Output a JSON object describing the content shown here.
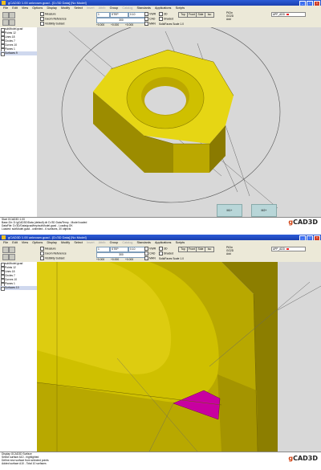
{
  "colors": {
    "nut_face": "#cfc000",
    "nut_light": "#ecdc18",
    "nut_dark": "#8c7e00",
    "highlight": "#c800a0",
    "viewport_bg": "#d8d8d8"
  },
  "window1": {
    "title": "gCAD3D 1.00   unknown.gcad  -  [D:/3D Data]   [No Model]",
    "menu": [
      "File",
      "Edit",
      "View",
      "Options",
      "Display",
      "Modify",
      "Select",
      "Insert",
      "Attrib",
      "Group",
      "Catalog",
      "Standards",
      "Applications",
      "Scripts"
    ],
    "menu_dim": [
      false,
      false,
      false,
      false,
      false,
      false,
      false,
      true,
      true,
      false,
      true,
      false,
      false,
      false
    ],
    "toolbar": {
      "checks": [
        "Measure",
        "Geom Reference",
        "Visibility Subset"
      ],
      "fields": [
        "1",
        "STEP",
        "0.10"
      ],
      "sub_fields": [
        "300",
        "+0.000",
        "+0.000",
        "+0.000"
      ],
      "mode_checks": [
        "VWR",
        "CAD",
        "MAN"
      ],
      "view_checks": [
        "3D",
        "Shaded",
        "Scale"
      ],
      "view_buttons": [
        "Top",
        "Front",
        "Side",
        "Iso"
      ],
      "right_info": [
        "PtCtn",
        "GO2D",
        "Add"
      ],
      "layer": "APP_ADD",
      "status": "SolidFaces   Scale  1.0"
    },
    "tree": [
      "subModel.gcad",
      "Points  12",
      "Lines  18",
      "Circles  7",
      "Curves  10",
      "Planes 1",
      "Surfaces 9"
    ],
    "tree_selected": 6,
    "viewport_buttons": [
      "M1+",
      "M2+"
    ],
    "messages": [
      "Start GCAD3D 1.00",
      "Base-Dir: D:\\gCAD3D\\Data (default)  dir  D:/3D Data/Temp  -  Model loaded",
      "DataFile: D:/3D/Data/gcad/tmp/subModel.gcad  -  Loading  OK",
      "Loaded: subModel.gcad - unlimited  -  6 surfaces, 30 objects"
    ],
    "logo_g": "g",
    "logo_rest": "CAD3D"
  },
  "window2": {
    "title": "gCAD3D 1.00   unknown.gcad  -  [D:/3D Data]   [No Model]",
    "menu": [
      "File",
      "Edit",
      "View",
      "Options",
      "Display",
      "Modify",
      "Select",
      "Insert",
      "Attrib",
      "Group",
      "Catalog",
      "Standards",
      "Applications",
      "Scripts"
    ],
    "menu_dim": [
      false,
      false,
      false,
      false,
      false,
      false,
      false,
      true,
      true,
      false,
      true,
      false,
      false,
      false
    ],
    "toolbar": {
      "checks": [
        "Measure",
        "Geom Reference",
        "Visibility Subset"
      ],
      "fields": [
        "1",
        "STEP",
        "0.10"
      ],
      "sub_fields": [
        "300",
        "+0.000",
        "+0.000",
        "+0.000"
      ],
      "mode_checks": [
        "VWR",
        "CAD",
        "MAN"
      ],
      "view_checks": [
        "3D",
        "Shaded",
        "Scale"
      ],
      "view_buttons": [
        "Top",
        "Front",
        "Side",
        "Iso"
      ],
      "right_info": [
        "PtCtn",
        "GO2D",
        "Add"
      ],
      "layer": "APP_ADD",
      "status": "SolidFaces   Scale  1.0"
    },
    "tree": [
      "subModel.gcad",
      "Points  12",
      "Lines  18",
      "Circles  7",
      "Curves  10",
      "Planes 1",
      "Surfaces 10"
    ],
    "tree_selected": 6,
    "messages": [
      "Display  GCAD3D  Surface",
      "Select   surface  A10  -  highlighted",
      "Define  new surface  from selected points",
      "Added surface  A10  -  Total  10  surfaces"
    ],
    "logo_g": "g",
    "logo_rest": "CAD3D"
  }
}
